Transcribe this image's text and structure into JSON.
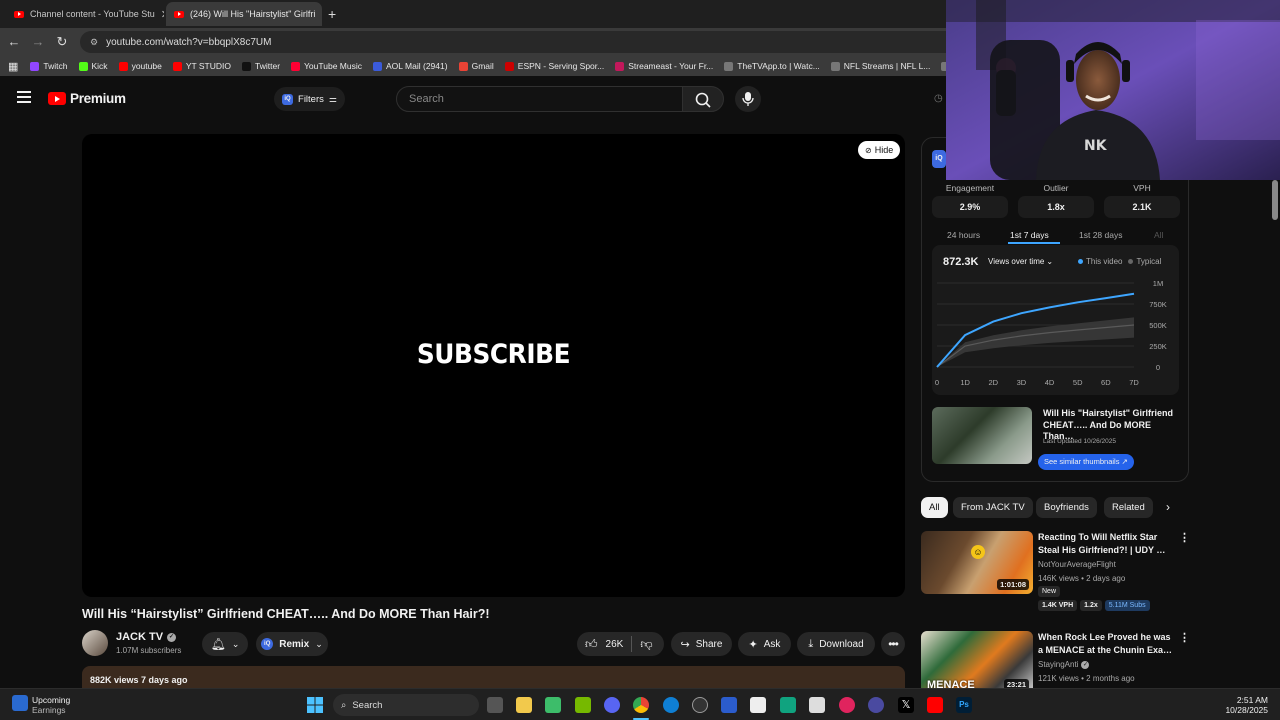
{
  "browser": {
    "tabs": [
      {
        "label": "Channel content - YouTube Stu"
      },
      {
        "label": "(246) Will His \"Hairstylist\" Girlfri"
      }
    ],
    "new_tab": "+",
    "url": "youtube.com/watch?v=bbqplX8c7UM",
    "bookmarks": [
      {
        "label": "Twitch",
        "color": "#9146ff"
      },
      {
        "label": "Kick",
        "color": "#53fc18"
      },
      {
        "label": "youtube",
        "color": "#ff0000"
      },
      {
        "label": "YT STUDIO",
        "color": "#ff0000"
      },
      {
        "label": "Twitter",
        "color": "#111111"
      },
      {
        "label": "YouTube Music",
        "color": "#ff0033"
      },
      {
        "label": "AOL Mail (2941)",
        "color": "#3b5bdb"
      },
      {
        "label": "Gmail",
        "color": "#ea4335"
      },
      {
        "label": "ESPN - Serving Spor...",
        "color": "#cc0000"
      },
      {
        "label": "Streameast - Your Fr...",
        "color": "#c2185b"
      },
      {
        "label": "TheTVApp.to | Watc...",
        "color": "#777777"
      },
      {
        "label": "NFL Streams | NFL L...",
        "color": "#777777"
      },
      {
        "label": "Fideli",
        "color": "#777777"
      }
    ]
  },
  "header": {
    "logo_text": "Premium",
    "filters_label": "Filters",
    "search_placeholder": "Search"
  },
  "player": {
    "overlay_text": "SUBSCRIBE",
    "hide_label": "Hide"
  },
  "video": {
    "title": "Will His “Hairstylist” Girlfriend CHEAT….. And Do MORE Than Hair?!",
    "channel": "JACK TV",
    "subscribers": "1.07M subscribers",
    "remix_label": "Remix",
    "likes": "26K",
    "share_label": "Share",
    "ask_label": "Ask",
    "download_label": "Download",
    "description_meta": "882K views  7 days ago"
  },
  "analytics": {
    "stats": [
      {
        "label": "Engagement",
        "value": "2.9%"
      },
      {
        "label": "Outlier",
        "value": "1.8x"
      },
      {
        "label": "VPH",
        "value": "2.1K"
      }
    ],
    "ranges": [
      "24 hours",
      "1st 7 days",
      "1st 28 days",
      "All"
    ],
    "active_range": "1st 7 days",
    "total_views": "872.3K",
    "dropdown": "Views over time",
    "legend": {
      "this_video": "This video",
      "typical": "Typical"
    },
    "thumb_title": "Will His \"Hairstylist\" Girlfriend CHEAT….. And Do MORE Than…",
    "last_updated": "Last Updated 10/26/2025",
    "similar_button": "See similar thumbnails ↗"
  },
  "chart_data": {
    "type": "line",
    "x": [
      "0",
      "1D",
      "2D",
      "3D",
      "4D",
      "5D",
      "6D",
      "7D"
    ],
    "y_ticks": [
      "0",
      "250K",
      "500K",
      "750K",
      "1M"
    ],
    "ylim": [
      0,
      1000000
    ],
    "series": [
      {
        "name": "This video",
        "color": "#3ea6ff",
        "values": [
          0,
          380000,
          540000,
          640000,
          710000,
          770000,
          820000,
          872300
        ]
      },
      {
        "name": "Typical",
        "color": "#5a5a5a",
        "values": [
          0,
          250000,
          320000,
          370000,
          410000,
          440000,
          470000,
          500000
        ]
      }
    ]
  },
  "chips": [
    "All",
    "From JACK TV",
    "Boyfriends",
    "Related"
  ],
  "recommendations": [
    {
      "title": "Reacting To Will Netflix Star Steal His Girlfriend?! | UDY …",
      "channel": "NotYourAverageFlight",
      "meta": "146K views • 2 days ago",
      "duration": "1:01:08",
      "new_badge": "New",
      "stats": [
        "1.4K VPH",
        "1.2x",
        "5.11M Subs"
      ]
    },
    {
      "title": "When Rock Lee Proved he was a MENACE at the Chunin Exa…",
      "channel": "StayingAnti",
      "meta": "121K views • 2 months ago",
      "duration": "23:21",
      "thumb_text": "MENACE"
    }
  ],
  "taskbar": {
    "widget_title": "Upcoming",
    "widget_sub": "Earnings",
    "search_label": "Search",
    "time": "2:51 AM",
    "date": "10/28/2025"
  }
}
